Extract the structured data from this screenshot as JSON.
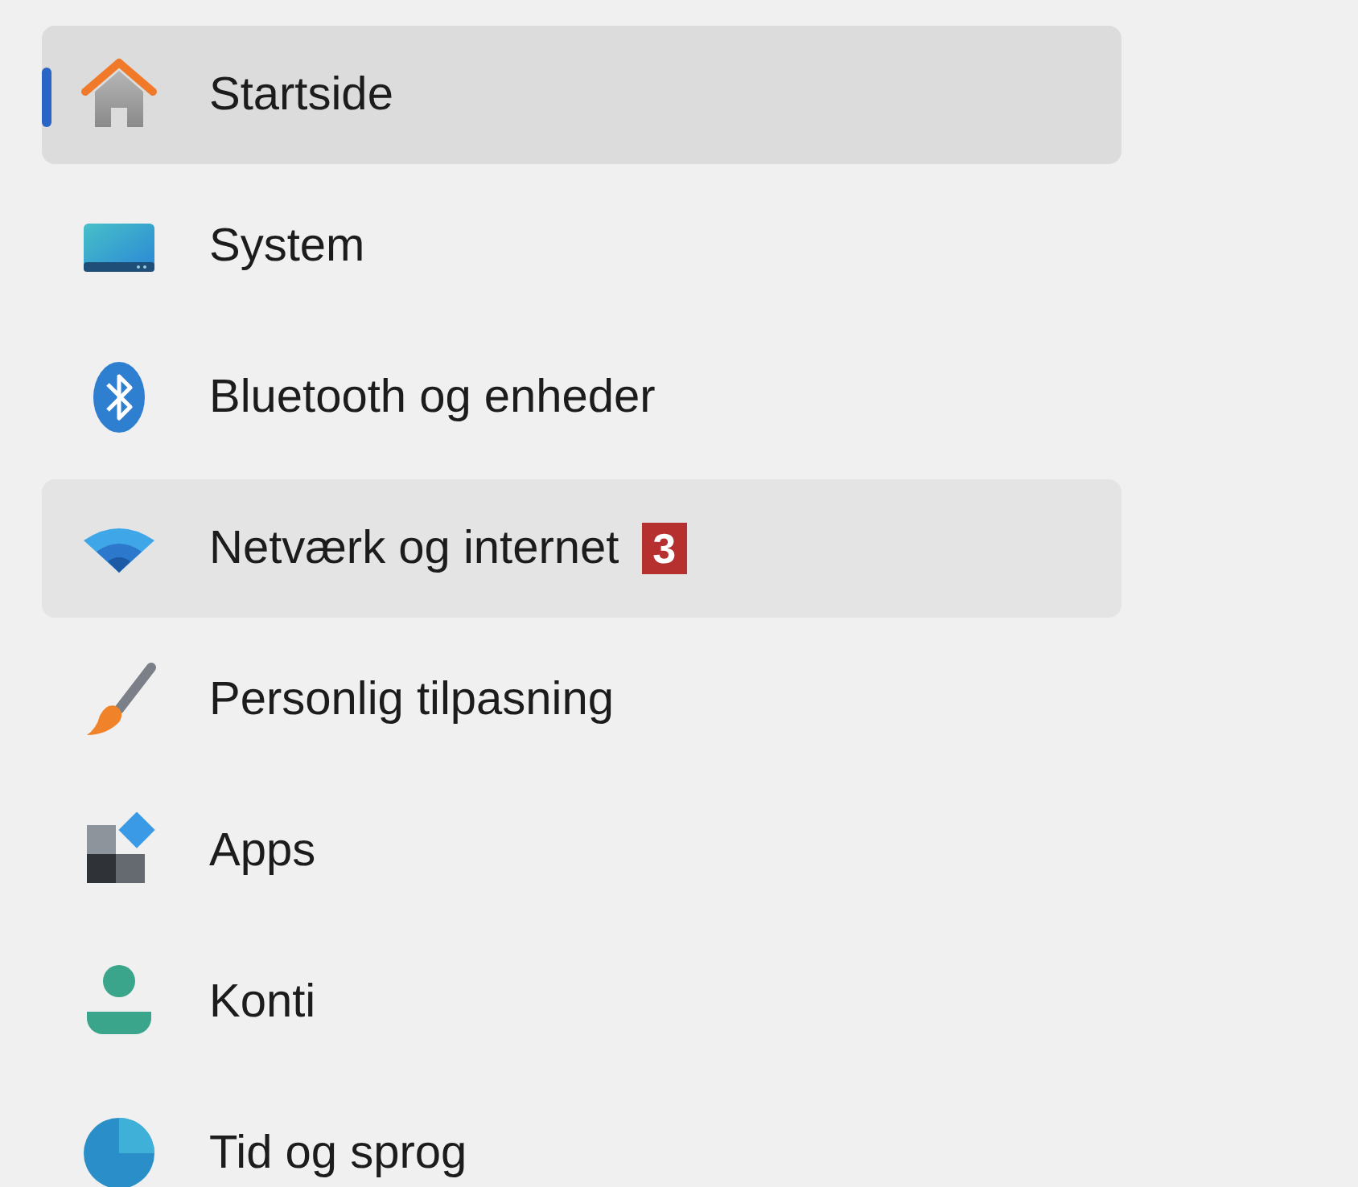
{
  "sidebar": {
    "items": [
      {
        "label": "Startside",
        "selected": true,
        "hovered": false
      },
      {
        "label": "System",
        "selected": false,
        "hovered": false
      },
      {
        "label": "Bluetooth og enheder",
        "selected": false,
        "hovered": false
      },
      {
        "label": "Netværk og internet",
        "selected": false,
        "hovered": true,
        "badge": "3"
      },
      {
        "label": "Personlig tilpasning",
        "selected": false,
        "hovered": false
      },
      {
        "label": "Apps",
        "selected": false,
        "hovered": false
      },
      {
        "label": "Konti",
        "selected": false,
        "hovered": false
      },
      {
        "label": "Tid og sprog",
        "selected": false,
        "hovered": false
      }
    ]
  }
}
